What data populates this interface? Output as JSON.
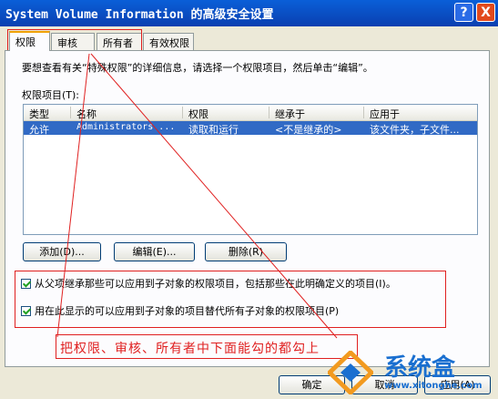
{
  "window": {
    "title": "System Volume Information 的高级安全设置",
    "help_label": "?",
    "close_label": "X"
  },
  "tabs": [
    {
      "label": "权限"
    },
    {
      "label": "审核"
    },
    {
      "label": "所有者"
    },
    {
      "label": "有效权限"
    }
  ],
  "permissions": {
    "description": "要想查看有关“特殊权限”的详细信息，请选择一个权限项目，然后单击“编辑”。",
    "list_label": "权限项目(T):",
    "columns": [
      "类型",
      "名称",
      "权限",
      "继承于",
      "应用于"
    ],
    "rows": [
      {
        "type": "允许",
        "name": "Administrators ...",
        "permission": "读取和运行",
        "inherited": "<不是继承的>",
        "apply_to": "该文件夹，子文件..."
      }
    ],
    "add_label": "添加(D)...",
    "edit_label": "编辑(E)...",
    "remove_label": "删除(R)"
  },
  "options": {
    "inherit_label": "从父项继承那些可以应用到子对象的权限项目，包括那些在此明确定义的项目(I)。",
    "replace_label": "用在此显示的可以应用到子对象的项目替代所有子对象的权限项目(P)"
  },
  "annotation": "把权限、审核、所有者中下面能勾的都勾上",
  "footer": {
    "ok_label": "确定",
    "cancel_label": "取消",
    "apply_label": "应用(A)"
  },
  "watermark": {
    "brand": "系统盒",
    "url": "www.xitonghe.com"
  },
  "colors": {
    "titlebar": "#0a3fb0",
    "selection": "#316ac5",
    "annotation": "#e02020"
  }
}
